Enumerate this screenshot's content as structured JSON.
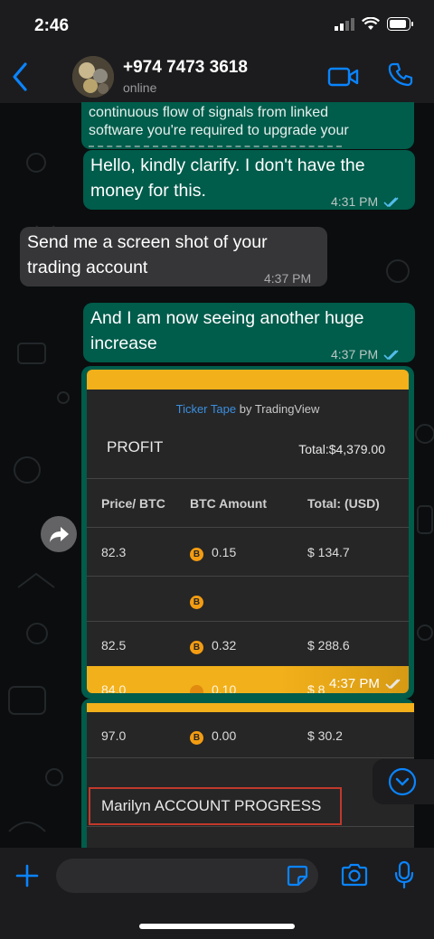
{
  "status_bar": {
    "time": "2:46"
  },
  "header": {
    "contact_name": "+974 7473 3618",
    "status": "online"
  },
  "messages": {
    "clipped": {
      "line1": "continuous flow of signals from linked",
      "line2": "software you're required to upgrade your"
    },
    "m1": {
      "line1": "Hello, kindly clarify. I don't have the",
      "line2": "money for this.",
      "time": "4:31 PM"
    },
    "m2": {
      "line1": "Send me a screen shot of your",
      "line2": "trading account",
      "time": "4:37 PM"
    },
    "m3": {
      "line1": "And I am now seeing another huge",
      "line2": "increase",
      "time": "4:37 PM"
    },
    "image_time": "4:37 PM"
  },
  "screenshot": {
    "ticker_link": "Ticker Tape",
    "ticker_by": "by TradingView",
    "profit_label": "PROFIT",
    "total": "Total:$4,379.00",
    "columns": [
      "Price/ BTC",
      "BTC Amount",
      "Total: (USD)"
    ],
    "rows": [
      {
        "price": "82.3",
        "amount": "0.15",
        "total": "$ 134.7"
      },
      {
        "price": "",
        "amount": "",
        "total": ""
      },
      {
        "price": "82.5",
        "amount": "0.32",
        "total": "$ 288.6"
      },
      {
        "price": "84.0",
        "amount": "0.10",
        "total": "$ 8"
      }
    ],
    "coin_symbol": "B"
  },
  "screenshot2": {
    "row": {
      "price": "97.0",
      "amount": "0.00",
      "total": "$ 30.2"
    },
    "account_progress": "Marilyn ACCOUNT PROGRESS"
  },
  "input": {
    "placeholder": ""
  },
  "colors": {
    "outgoing": "#005c4b",
    "incoming": "#363638",
    "accent": "#0a84ff",
    "brand_yellow": "#f2b01a"
  }
}
